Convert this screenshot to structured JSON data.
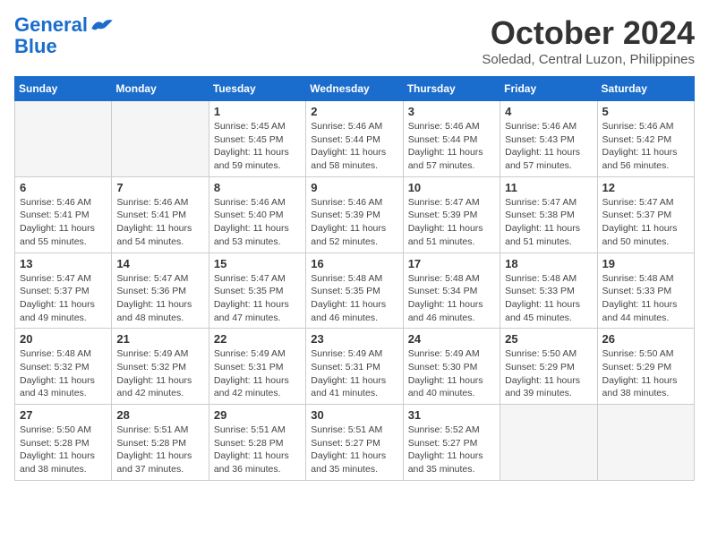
{
  "logo": {
    "line1": "General",
    "line2": "Blue"
  },
  "title": "October 2024",
  "subtitle": "Soledad, Central Luzon, Philippines",
  "days_header": [
    "Sunday",
    "Monday",
    "Tuesday",
    "Wednesday",
    "Thursday",
    "Friday",
    "Saturday"
  ],
  "weeks": [
    [
      {
        "day": "",
        "detail": ""
      },
      {
        "day": "",
        "detail": ""
      },
      {
        "day": "1",
        "detail": "Sunrise: 5:45 AM\nSunset: 5:45 PM\nDaylight: 11 hours and 59 minutes."
      },
      {
        "day": "2",
        "detail": "Sunrise: 5:46 AM\nSunset: 5:44 PM\nDaylight: 11 hours and 58 minutes."
      },
      {
        "day": "3",
        "detail": "Sunrise: 5:46 AM\nSunset: 5:44 PM\nDaylight: 11 hours and 57 minutes."
      },
      {
        "day": "4",
        "detail": "Sunrise: 5:46 AM\nSunset: 5:43 PM\nDaylight: 11 hours and 57 minutes."
      },
      {
        "day": "5",
        "detail": "Sunrise: 5:46 AM\nSunset: 5:42 PM\nDaylight: 11 hours and 56 minutes."
      }
    ],
    [
      {
        "day": "6",
        "detail": "Sunrise: 5:46 AM\nSunset: 5:41 PM\nDaylight: 11 hours and 55 minutes."
      },
      {
        "day": "7",
        "detail": "Sunrise: 5:46 AM\nSunset: 5:41 PM\nDaylight: 11 hours and 54 minutes."
      },
      {
        "day": "8",
        "detail": "Sunrise: 5:46 AM\nSunset: 5:40 PM\nDaylight: 11 hours and 53 minutes."
      },
      {
        "day": "9",
        "detail": "Sunrise: 5:46 AM\nSunset: 5:39 PM\nDaylight: 11 hours and 52 minutes."
      },
      {
        "day": "10",
        "detail": "Sunrise: 5:47 AM\nSunset: 5:39 PM\nDaylight: 11 hours and 51 minutes."
      },
      {
        "day": "11",
        "detail": "Sunrise: 5:47 AM\nSunset: 5:38 PM\nDaylight: 11 hours and 51 minutes."
      },
      {
        "day": "12",
        "detail": "Sunrise: 5:47 AM\nSunset: 5:37 PM\nDaylight: 11 hours and 50 minutes."
      }
    ],
    [
      {
        "day": "13",
        "detail": "Sunrise: 5:47 AM\nSunset: 5:37 PM\nDaylight: 11 hours and 49 minutes."
      },
      {
        "day": "14",
        "detail": "Sunrise: 5:47 AM\nSunset: 5:36 PM\nDaylight: 11 hours and 48 minutes."
      },
      {
        "day": "15",
        "detail": "Sunrise: 5:47 AM\nSunset: 5:35 PM\nDaylight: 11 hours and 47 minutes."
      },
      {
        "day": "16",
        "detail": "Sunrise: 5:48 AM\nSunset: 5:35 PM\nDaylight: 11 hours and 46 minutes."
      },
      {
        "day": "17",
        "detail": "Sunrise: 5:48 AM\nSunset: 5:34 PM\nDaylight: 11 hours and 46 minutes."
      },
      {
        "day": "18",
        "detail": "Sunrise: 5:48 AM\nSunset: 5:33 PM\nDaylight: 11 hours and 45 minutes."
      },
      {
        "day": "19",
        "detail": "Sunrise: 5:48 AM\nSunset: 5:33 PM\nDaylight: 11 hours and 44 minutes."
      }
    ],
    [
      {
        "day": "20",
        "detail": "Sunrise: 5:48 AM\nSunset: 5:32 PM\nDaylight: 11 hours and 43 minutes."
      },
      {
        "day": "21",
        "detail": "Sunrise: 5:49 AM\nSunset: 5:32 PM\nDaylight: 11 hours and 42 minutes."
      },
      {
        "day": "22",
        "detail": "Sunrise: 5:49 AM\nSunset: 5:31 PM\nDaylight: 11 hours and 42 minutes."
      },
      {
        "day": "23",
        "detail": "Sunrise: 5:49 AM\nSunset: 5:31 PM\nDaylight: 11 hours and 41 minutes."
      },
      {
        "day": "24",
        "detail": "Sunrise: 5:49 AM\nSunset: 5:30 PM\nDaylight: 11 hours and 40 minutes."
      },
      {
        "day": "25",
        "detail": "Sunrise: 5:50 AM\nSunset: 5:29 PM\nDaylight: 11 hours and 39 minutes."
      },
      {
        "day": "26",
        "detail": "Sunrise: 5:50 AM\nSunset: 5:29 PM\nDaylight: 11 hours and 38 minutes."
      }
    ],
    [
      {
        "day": "27",
        "detail": "Sunrise: 5:50 AM\nSunset: 5:28 PM\nDaylight: 11 hours and 38 minutes."
      },
      {
        "day": "28",
        "detail": "Sunrise: 5:51 AM\nSunset: 5:28 PM\nDaylight: 11 hours and 37 minutes."
      },
      {
        "day": "29",
        "detail": "Sunrise: 5:51 AM\nSunset: 5:28 PM\nDaylight: 11 hours and 36 minutes."
      },
      {
        "day": "30",
        "detail": "Sunrise: 5:51 AM\nSunset: 5:27 PM\nDaylight: 11 hours and 35 minutes."
      },
      {
        "day": "31",
        "detail": "Sunrise: 5:52 AM\nSunset: 5:27 PM\nDaylight: 11 hours and 35 minutes."
      },
      {
        "day": "",
        "detail": ""
      },
      {
        "day": "",
        "detail": ""
      }
    ]
  ]
}
